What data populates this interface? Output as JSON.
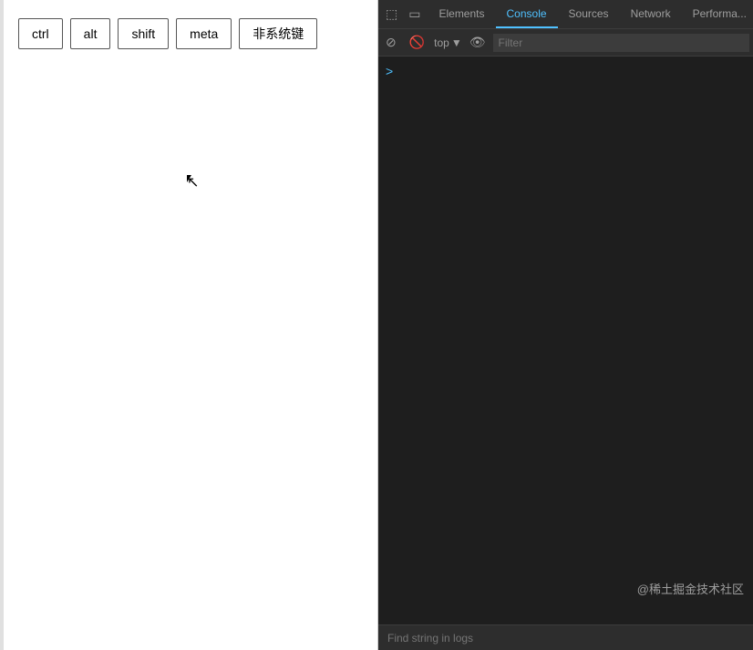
{
  "left_panel": {
    "keys": [
      {
        "label": "ctrl",
        "id": "ctrl-btn"
      },
      {
        "label": "alt",
        "id": "alt-btn"
      },
      {
        "label": "shift",
        "id": "shift-btn"
      },
      {
        "label": "meta",
        "id": "meta-btn"
      },
      {
        "label": "非系统键",
        "id": "nonsystem-btn"
      }
    ]
  },
  "devtools": {
    "tabs": [
      {
        "label": "Elements",
        "active": false
      },
      {
        "label": "Console",
        "active": true
      },
      {
        "label": "Sources",
        "active": false
      },
      {
        "label": "Network",
        "active": false
      },
      {
        "label": "Performa...",
        "active": false
      }
    ],
    "console_toolbar": {
      "top_label": "top",
      "filter_placeholder": "Filter"
    },
    "find_placeholder": "Find string in logs",
    "watermark": "@稀土掘金技术社区",
    "prompt_symbol": ">"
  }
}
